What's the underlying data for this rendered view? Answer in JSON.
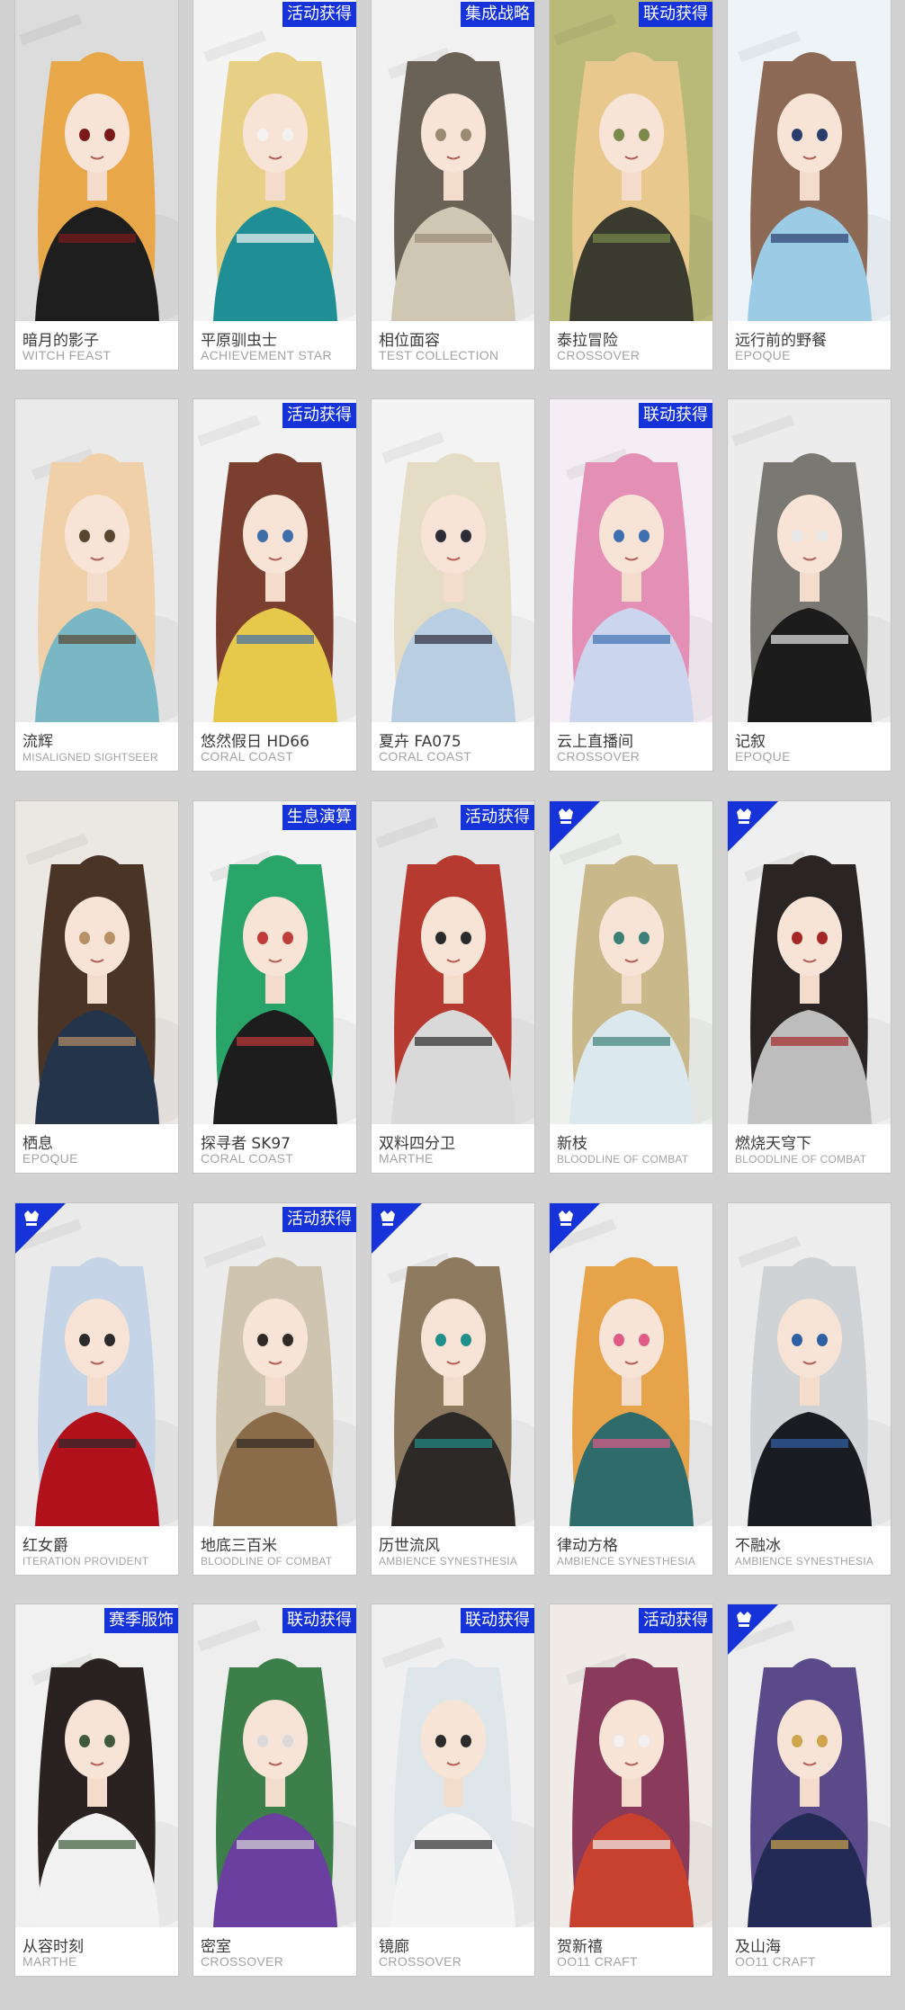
{
  "skins": [
    {
      "name": "暗月的影子",
      "series": "WITCH FEAST",
      "tag": "",
      "badge": false,
      "colors": {
        "bg": "#dcdcdc",
        "hair": "#e8a84a",
        "outfit": "#1e1e1e",
        "accent": "#7a1a1a"
      }
    },
    {
      "name": "平原驯虫士",
      "series": "ACHIEVEMENT STAR",
      "tag": "活动获得",
      "badge": false,
      "colors": {
        "bg": "#f4f4f4",
        "hair": "#e8cf86",
        "outfit": "#1f8f95",
        "accent": "#f2f2f2"
      }
    },
    {
      "name": "相位面容",
      "series": "TEST COLLECTION",
      "tag": "集成战略",
      "badge": false,
      "colors": {
        "bg": "#f1f1f1",
        "hair": "#6b6257",
        "outfit": "#cfc6b4",
        "accent": "#9a8c74"
      }
    },
    {
      "name": "泰拉冒险",
      "series": "CROSSOVER",
      "tag": "联动获得",
      "badge": false,
      "colors": {
        "bg": "#b9ba78",
        "hair": "#e9c88d",
        "outfit": "#3a3b2e",
        "accent": "#7b8a4b"
      }
    },
    {
      "name": "远行前的野餐",
      "series": "EPOQUE",
      "tag": "",
      "badge": false,
      "colors": {
        "bg": "#eef3f7",
        "hair": "#8c6a55",
        "outfit": "#9ccbe6",
        "accent": "#2b3d6b"
      }
    },
    {
      "name": "流辉",
      "series": "MISALIGNED SIGHTSEER",
      "tag": "",
      "badge": false,
      "colors": {
        "bg": "#eaeaea",
        "hair": "#f0d0a8",
        "outfit": "#7ab7c4",
        "accent": "#5a4630"
      }
    },
    {
      "name": "悠然假日 HD66",
      "series": "CORAL COAST",
      "tag": "活动获得",
      "badge": false,
      "colors": {
        "bg": "#f2f2f2",
        "hair": "#7a3f2e",
        "outfit": "#e6c84a",
        "accent": "#3e6ea8"
      }
    },
    {
      "name": "夏卉 FA075",
      "series": "CORAL COAST",
      "tag": "",
      "badge": false,
      "colors": {
        "bg": "#f3f3f3",
        "hair": "#e4dcc4",
        "outfit": "#b9cde3",
        "accent": "#2d2d3a"
      }
    },
    {
      "name": "云上直播间",
      "series": "CROSSOVER",
      "tag": "联动获得",
      "badge": false,
      "colors": {
        "bg": "#f4eef4",
        "hair": "#e48fb6",
        "outfit": "#cbd6ee",
        "accent": "#3d6fb0"
      }
    },
    {
      "name": "记叙",
      "series": "EPOQUE",
      "tag": "",
      "badge": false,
      "colors": {
        "bg": "#ececec",
        "hair": "#7a7872",
        "outfit": "#1c1c1c",
        "accent": "#e8e8e8"
      }
    },
    {
      "name": "栖息",
      "series": "EPOQUE",
      "tag": "",
      "badge": false,
      "colors": {
        "bg": "#ebe8e4",
        "hair": "#4a3426",
        "outfit": "#24344a",
        "accent": "#b89066"
      }
    },
    {
      "name": "探寻者 SK97",
      "series": "CORAL COAST",
      "tag": "生息演算",
      "badge": false,
      "colors": {
        "bg": "#f3f3f3",
        "hair": "#2aa56a",
        "outfit": "#1d1d1d",
        "accent": "#c23b3b"
      }
    },
    {
      "name": "双料四分卫",
      "series": "MARTHE",
      "tag": "活动获得",
      "badge": false,
      "colors": {
        "bg": "#e6e6e6",
        "hair": "#b63a2f",
        "outfit": "#d9d9d9",
        "accent": "#2a2a2a"
      }
    },
    {
      "name": "新枝",
      "series": "BLOODLINE OF COMBAT",
      "tag": "",
      "badge": true,
      "colors": {
        "bg": "#eef0ee",
        "hair": "#c9b889",
        "outfit": "#dbe9ee",
        "accent": "#3f7f7a"
      }
    },
    {
      "name": "燃烧天穹下",
      "series": "BLOODLINE OF COMBAT",
      "tag": "",
      "badge": true,
      "colors": {
        "bg": "#efefef",
        "hair": "#2a2424",
        "outfit": "#bdbdbd",
        "accent": "#a52626"
      }
    },
    {
      "name": "红女爵",
      "series": "ITERATION PROVIDENT",
      "tag": "",
      "badge": true,
      "colors": {
        "bg": "#eaeaea",
        "hair": "#c5d4e6",
        "outfit": "#b0111b",
        "accent": "#2b2b2b"
      }
    },
    {
      "name": "地底三百米",
      "series": "BLOODLINE OF COMBAT",
      "tag": "活动获得",
      "badge": false,
      "colors": {
        "bg": "#ececec",
        "hair": "#cfc4b0",
        "outfit": "#8a6b4a",
        "accent": "#2f2a25"
      }
    },
    {
      "name": "历世流风",
      "series": "AMBIENCE SYNESTHESIA",
      "tag": "",
      "badge": true,
      "colors": {
        "bg": "#f0f0f0",
        "hair": "#8d7a5f",
        "outfit": "#2d2926",
        "accent": "#1f8f89"
      }
    },
    {
      "name": "律动方格",
      "series": "AMBIENCE SYNESTHESIA",
      "tag": "",
      "badge": true,
      "colors": {
        "bg": "#eeeeee",
        "hair": "#e6a34a",
        "outfit": "#2f6b6a",
        "accent": "#e05a88"
      }
    },
    {
      "name": "不融冰",
      "series": "AMBIENCE SYNESTHESIA",
      "tag": "",
      "badge": false,
      "colors": {
        "bg": "#ededed",
        "hair": "#cfd3d6",
        "outfit": "#1b1b22",
        "accent": "#2f5fa5"
      }
    },
    {
      "name": "从容时刻",
      "series": "MARTHE",
      "tag": "赛季服饰",
      "badge": false,
      "colors": {
        "bg": "#f1f1f1",
        "hair": "#2a2220",
        "outfit": "#f2f2f2",
        "accent": "#3f5a3a"
      }
    },
    {
      "name": "密室",
      "series": "CROSSOVER",
      "tag": "联动获得",
      "badge": false,
      "colors": {
        "bg": "#eeeeee",
        "hair": "#3d7f4a",
        "outfit": "#6a3fa0",
        "accent": "#d9d9d9"
      }
    },
    {
      "name": "镜廊",
      "series": "CROSSOVER",
      "tag": "联动获得",
      "badge": false,
      "colors": {
        "bg": "#f0f0f0",
        "hair": "#dfe6ea",
        "outfit": "#f4f4f4",
        "accent": "#2b2b2b"
      }
    },
    {
      "name": "贺新禧",
      "series": "OO11 CRAFT",
      "tag": "活动获得",
      "badge": false,
      "colors": {
        "bg": "#f0ebe6",
        "hair": "#8a3a5a",
        "outfit": "#c8412f",
        "accent": "#f1f1f1"
      }
    },
    {
      "name": "及山海",
      "series": "OO11 CRAFT",
      "tag": "",
      "badge": true,
      "colors": {
        "bg": "#eeeeee",
        "hair": "#5a4a8a",
        "outfit": "#232a55",
        "accent": "#cfa44a"
      }
    }
  ]
}
